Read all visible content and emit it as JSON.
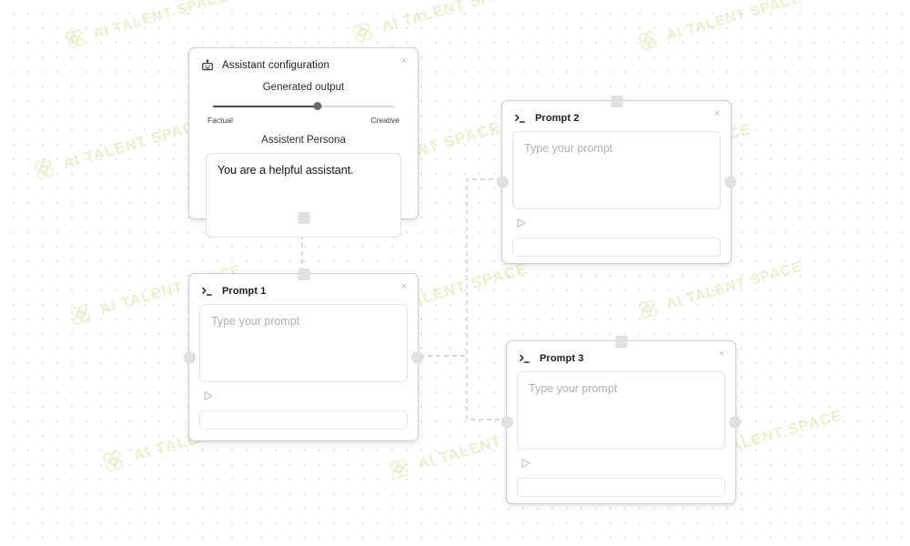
{
  "canvas": {
    "background_color": "#ffffff",
    "dot_color": "#d8d8d8",
    "watermark_text": "AI TALENT SPACE",
    "watermark_color": "#cfe8a8"
  },
  "nodes": {
    "assistant_config": {
      "title": "Assistant configuration",
      "icon": "robot-icon",
      "close_label": "×",
      "output_label": "Generated output",
      "slider": {
        "min_label": "Factual",
        "max_label": "Creative",
        "value_percent": 58,
        "fill_color": "#4a4a4a",
        "track_color": "#dadada"
      },
      "persona_label": "Assistent Persona",
      "persona_value": "You are a helpful assistant."
    },
    "prompt1": {
      "title": "Prompt 1",
      "icon": "terminal-prompt-icon",
      "close_label": "×",
      "input_placeholder": "Type your prompt",
      "input_value": "",
      "run_icon": "play-icon",
      "output_value": ""
    },
    "prompt2": {
      "title": "Prompt 2",
      "icon": "terminal-prompt-icon",
      "close_label": "×",
      "input_placeholder": "Type your prompt",
      "input_value": "",
      "run_icon": "play-icon",
      "output_value": ""
    },
    "prompt3": {
      "title": "Prompt 3",
      "icon": "terminal-prompt-icon",
      "close_label": "×",
      "input_placeholder": "Type your prompt",
      "input_value": "",
      "run_icon": "play-icon",
      "output_value": ""
    }
  },
  "edges": {
    "style": "dashed",
    "color": "#cccccc",
    "connections": [
      {
        "from": "assistant_config-bottom",
        "to": "prompt1-top"
      },
      {
        "from": "prompt1-left",
        "to": "prompt2-left"
      },
      {
        "from": "prompt1-left",
        "to": "prompt3-left"
      }
    ]
  }
}
